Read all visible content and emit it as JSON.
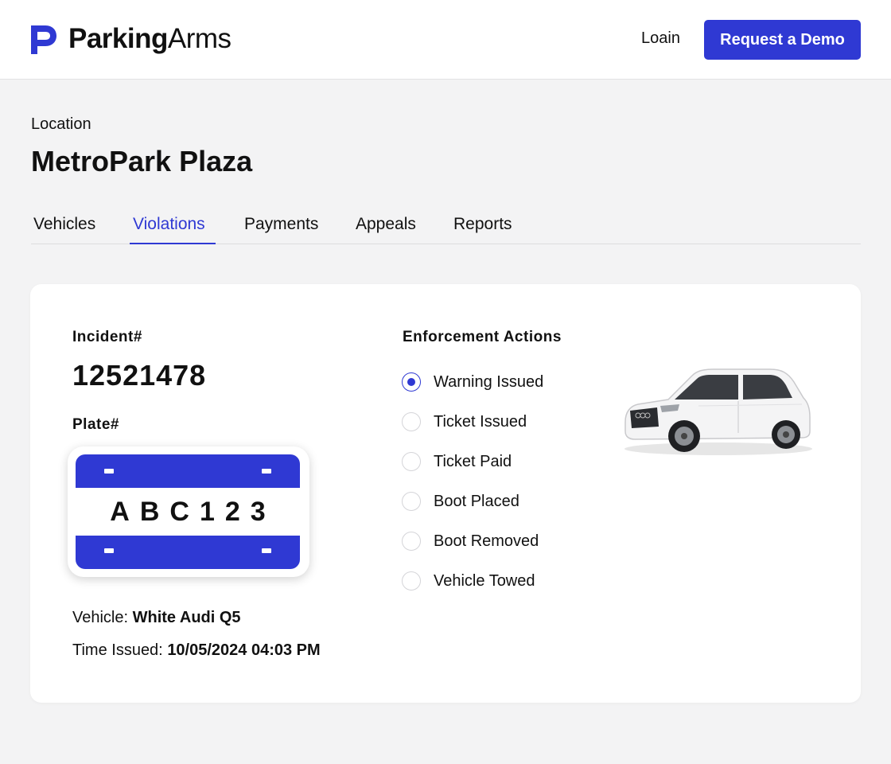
{
  "header": {
    "brand_bold": "Parking",
    "brand_regular": "Arms",
    "login_label": "Loain",
    "demo_label": "Request a Demo",
    "accent_color": "#2f39d3"
  },
  "location": {
    "label": "Location",
    "name": "MetroPark Plaza"
  },
  "tabs": [
    {
      "label": "Vehicles",
      "active": false
    },
    {
      "label": "Violations",
      "active": true
    },
    {
      "label": "Payments",
      "active": false
    },
    {
      "label": "Appeals",
      "active": false
    },
    {
      "label": "Reports",
      "active": false
    }
  ],
  "incident": {
    "label": "Incident#",
    "number": "12521478",
    "plate_label": "Plate#",
    "plate_text": "ABC123",
    "vehicle_label": "Vehicle:",
    "vehicle_value": "White Audi Q5",
    "time_label": "Time Issued:",
    "time_value": "10/05/2024 04:03 PM"
  },
  "enforcement": {
    "title": "Enforcement Actions",
    "options": [
      {
        "label": "Warning Issued",
        "checked": true
      },
      {
        "label": "Ticket Issued",
        "checked": false
      },
      {
        "label": "Ticket Paid",
        "checked": false
      },
      {
        "label": "Boot Placed",
        "checked": false
      },
      {
        "label": "Boot Removed",
        "checked": false
      },
      {
        "label": "Vehicle Towed",
        "checked": false
      }
    ],
    "car_image_icon": "white-suv-car-icon"
  }
}
